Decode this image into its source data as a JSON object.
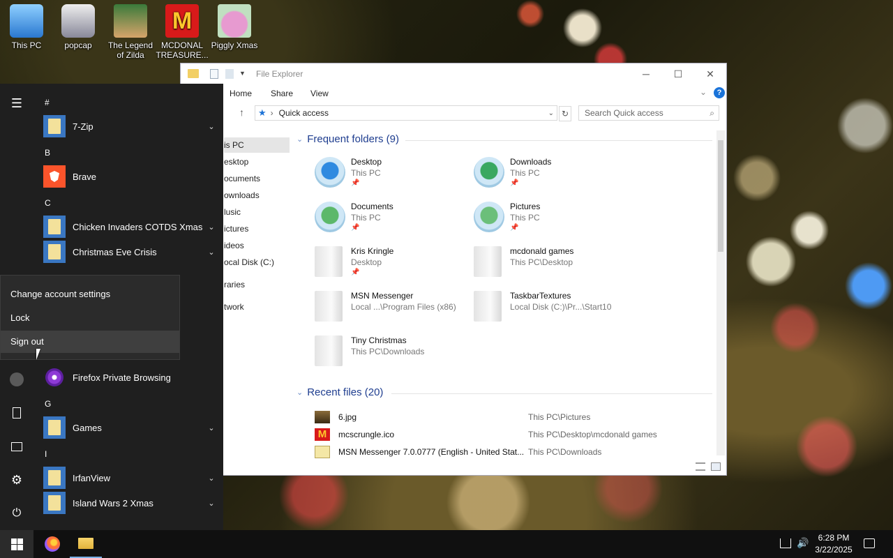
{
  "desktop": {
    "icons": [
      {
        "label": "This PC",
        "icon": "this-pc-icon"
      },
      {
        "label": "popcap",
        "icon": "popcap-icon"
      },
      {
        "label": "The Legend of Zilda",
        "icon": "zelda-game-icon"
      },
      {
        "label": "MCDONAL TREASURE...",
        "icon": "mcdonalds-icon"
      },
      {
        "label": "Piggly Xmas",
        "icon": "piggly-icon"
      }
    ]
  },
  "start_menu": {
    "letters": {
      "hash": "#",
      "b": "B",
      "c": "C",
      "g": "G",
      "i": "I"
    },
    "apps": {
      "zip": "7-Zip",
      "brave": "Brave",
      "chicken": "Chicken Invaders COTDS Xmas",
      "christmas": "Christmas Eve Crisis",
      "firefox_private": "Firefox Private Browsing",
      "games": "Games",
      "irfan": "IrfanView",
      "island": "Island Wars 2 Xmas"
    },
    "account_menu": {
      "change": "Change account settings",
      "lock": "Lock",
      "sign_out": "Sign out"
    }
  },
  "explorer": {
    "title": "File Explorer",
    "ribbon": {
      "home": "Home",
      "share": "Share",
      "view": "View"
    },
    "address": "Quick access",
    "search_placeholder": "Search Quick access",
    "nav": [
      "is PC",
      "esktop",
      "ocuments",
      "ownloads",
      "lusic",
      "ictures",
      "ideos",
      "ocal Disk (C:)",
      "raries",
      "twork"
    ],
    "frequent_header": "Frequent folders (9)",
    "frequent": [
      {
        "name": "Desktop",
        "loc": "This PC",
        "pinned": true,
        "icon": "desktop-folder-icon"
      },
      {
        "name": "Downloads",
        "loc": "This PC",
        "pinned": true,
        "icon": "downloads-folder-icon"
      },
      {
        "name": "Documents",
        "loc": "This PC",
        "pinned": true,
        "icon": "documents-folder-icon"
      },
      {
        "name": "Pictures",
        "loc": "This PC",
        "pinned": true,
        "icon": "pictures-folder-icon"
      },
      {
        "name": "Kris Kringle",
        "loc": "Desktop",
        "pinned": true,
        "icon": "folder-icon"
      },
      {
        "name": "mcdonald games",
        "loc": "This PC\\Desktop",
        "pinned": false,
        "icon": "folder-icon"
      },
      {
        "name": "MSN Messenger",
        "loc": "Local ...\\Program Files (x86)",
        "pinned": false,
        "icon": "folder-icon"
      },
      {
        "name": "TaskbarTextures",
        "loc": "Local Disk (C:)\\Pr...\\Start10",
        "pinned": false,
        "icon": "folder-icon"
      },
      {
        "name": "Tiny Christmas",
        "loc": "This PC\\Downloads",
        "pinned": false,
        "icon": "folder-icon"
      }
    ],
    "recent_header": "Recent files (20)",
    "recent": [
      {
        "name": "6.jpg",
        "path": "This PC\\Pictures",
        "icon": "image-file-icon"
      },
      {
        "name": "mcscrungle.ico",
        "path": "This PC\\Desktop\\mcdonald games",
        "icon": "mcdonalds-file-icon"
      },
      {
        "name": "MSN Messenger 7.0.0777 (English - United Stat...",
        "path": "This PC\\Downloads",
        "icon": "installer-file-icon"
      }
    ]
  },
  "taskbar": {
    "time": "6:28 PM",
    "date": "3/22/2025"
  },
  "colors": {
    "start_bg": "#1f1f1f",
    "accent": "#3a77c2",
    "group_header": "#1e3d8f",
    "taskbar": "#101010"
  }
}
